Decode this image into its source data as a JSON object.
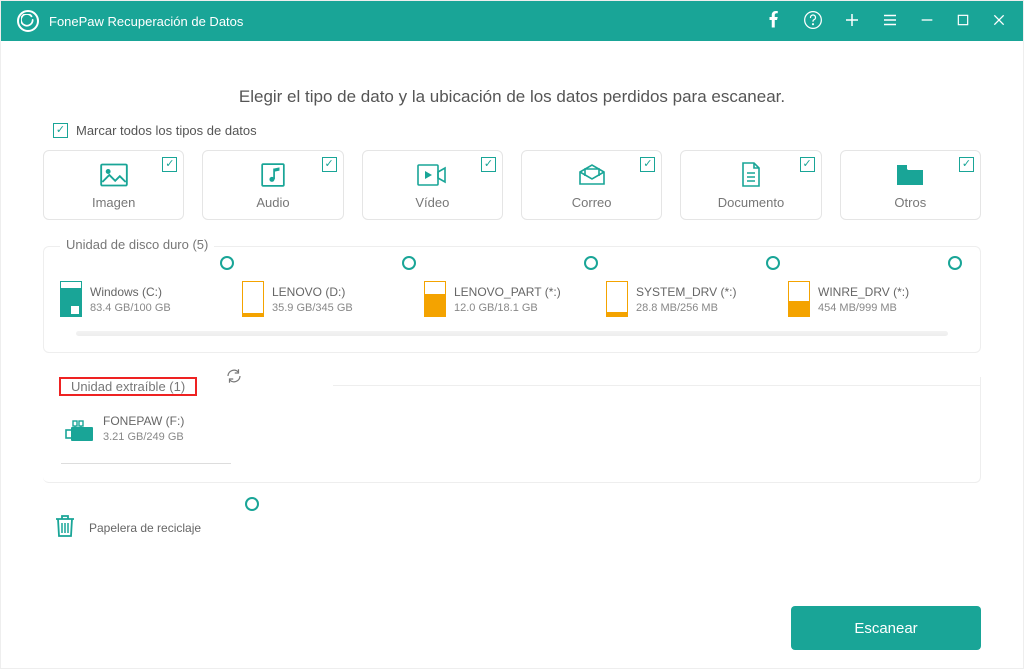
{
  "titlebar": {
    "app_name": "FonePaw Recuperación de Datos"
  },
  "heading": "Elegir el tipo de dato y la ubicación de los datos perdidos para escanear.",
  "check_all_label": "Marcar todos los tipos de datos",
  "types": {
    "image": "Imagen",
    "audio": "Audio",
    "video": "Vídeo",
    "mail": "Correo",
    "document": "Documento",
    "other": "Otros"
  },
  "hdd_section_title": "Unidad de disco duro (5)",
  "disks": [
    {
      "name": "Windows (C:)",
      "size": "83.4 GB/100 GB",
      "fill": 83,
      "teal": true,
      "win": true
    },
    {
      "name": "LENOVO (D:)",
      "size": "35.9 GB/345 GB",
      "fill": 10,
      "teal": false
    },
    {
      "name": "LENOVO_PART (*:)",
      "size": "12.0 GB/18.1 GB",
      "fill": 66,
      "teal": false
    },
    {
      "name": "SYSTEM_DRV (*:)",
      "size": "28.8 MB/256 MB",
      "fill": 11,
      "teal": false
    },
    {
      "name": "WINRE_DRV (*:)",
      "size": "454 MB/999 MB",
      "fill": 45,
      "teal": false
    }
  ],
  "removable_section_title": "Unidad extraíble (1)",
  "removable": {
    "name": "FONEPAW (F:)",
    "size": "3.21 GB/249 GB"
  },
  "recycle_label": "Papelera de reciclaje",
  "scan_button": "Escanear"
}
